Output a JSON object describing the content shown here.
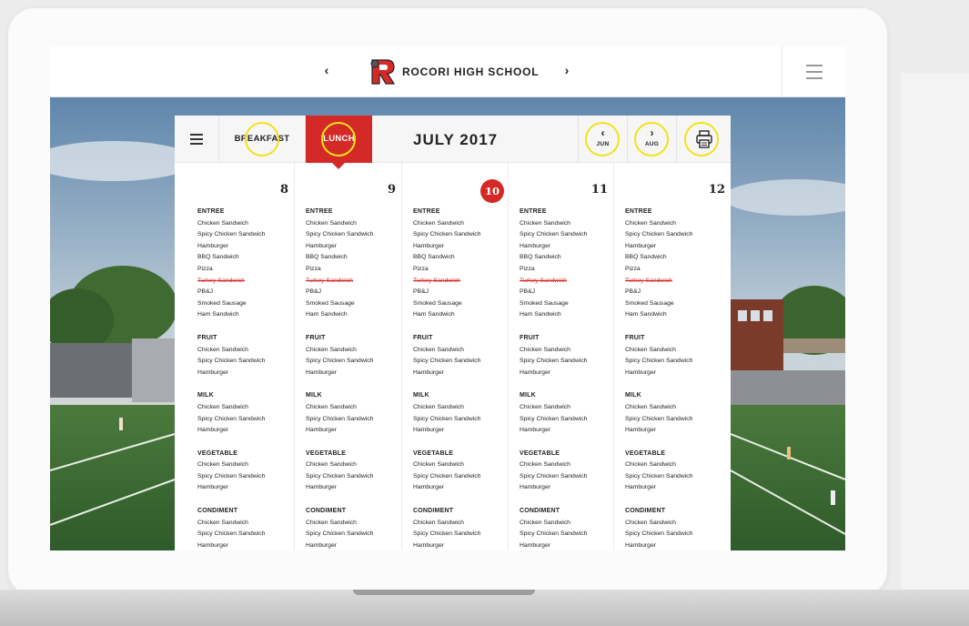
{
  "header": {
    "prev_arrow": "‹",
    "next_arrow": "›",
    "school_name": "ROCORI HIGH SCHOOL"
  },
  "tabs": {
    "breakfast": "BREAKFAST",
    "lunch": "LUNCH",
    "active": "LUNCH"
  },
  "calendar": {
    "month_title": "JULY 2017",
    "prev_arrow": "‹",
    "prev_label": "JUN",
    "next_arrow": "›",
    "next_label": "AUG"
  },
  "icons": {
    "logo": "school-mascot-logo",
    "menu": "menu-icon",
    "print": "printer-icon",
    "hamburger": "hamburger-icon"
  },
  "colors": {
    "accent": "#d42a27",
    "highlight_ring": "#f2e21b"
  },
  "days": [
    {
      "date": "8",
      "today": false,
      "sections": [
        {
          "title": "ENTREE",
          "items": [
            {
              "text": "Chicken Sandwich"
            },
            {
              "text": "Spicy Chicken Sandwich"
            },
            {
              "text": "Hamburger"
            },
            {
              "text": "BBQ Sandwich"
            },
            {
              "text": "Pizza"
            },
            {
              "text": "Turkey Sandwich",
              "struck": true
            },
            {
              "text": "PB&J"
            },
            {
              "text": "Smoked Sausage"
            },
            {
              "text": "Ham Sandwich"
            }
          ]
        },
        {
          "title": "FRUIT",
          "items": [
            {
              "text": "Chicken Sandwich"
            },
            {
              "text": "Spicy Chicken Sandwich"
            },
            {
              "text": "Hamburger"
            }
          ]
        },
        {
          "title": "MILK",
          "items": [
            {
              "text": "Chicken Sandwich"
            },
            {
              "text": "Spicy Chicken Sandwich"
            },
            {
              "text": "Hamburger"
            }
          ]
        },
        {
          "title": "VEGETABLE",
          "items": [
            {
              "text": "Chicken Sandwich"
            },
            {
              "text": "Spicy Chicken Sandwich"
            },
            {
              "text": "Hamburger"
            }
          ]
        },
        {
          "title": "CONDIMENT",
          "items": [
            {
              "text": "Chicken Sandwich"
            },
            {
              "text": "Spicy Chicken Sandwich"
            },
            {
              "text": "Hamburger"
            }
          ]
        }
      ]
    },
    {
      "date": "9",
      "today": false,
      "sections": [
        {
          "title": "ENTREE",
          "items": [
            {
              "text": "Chicken Sandwich"
            },
            {
              "text": "Spicy Chicken Sandwich"
            },
            {
              "text": "Hamburger"
            },
            {
              "text": "BBQ Sandwich"
            },
            {
              "text": "Pizza"
            },
            {
              "text": "Turkey Sandwich",
              "struck": true
            },
            {
              "text": "PB&J"
            },
            {
              "text": "Smoked Sausage"
            },
            {
              "text": "Ham Sandwich"
            }
          ]
        },
        {
          "title": "FRUIT",
          "items": [
            {
              "text": "Chicken Sandwich"
            },
            {
              "text": "Spicy Chicken Sandwich"
            },
            {
              "text": "Hamburger"
            }
          ]
        },
        {
          "title": "MILK",
          "items": [
            {
              "text": "Chicken Sandwich"
            },
            {
              "text": "Spicy Chicken Sandwich"
            },
            {
              "text": "Hamburger"
            }
          ]
        },
        {
          "title": "VEGETABLE",
          "items": [
            {
              "text": "Chicken Sandwich"
            },
            {
              "text": "Spicy Chicken Sandwich"
            },
            {
              "text": "Hamburger"
            }
          ]
        },
        {
          "title": "CONDIMENT",
          "items": [
            {
              "text": "Chicken Sandwich"
            },
            {
              "text": "Spicy Chicken Sandwich"
            },
            {
              "text": "Hamburger"
            }
          ]
        }
      ]
    },
    {
      "date": "10",
      "today": true,
      "sections": [
        {
          "title": "ENTREE",
          "items": [
            {
              "text": "Chicken Sandwich"
            },
            {
              "text": "Spicy Chicken Sandwich"
            },
            {
              "text": "Hamburger"
            },
            {
              "text": "BBQ Sandwich"
            },
            {
              "text": "Pizza"
            },
            {
              "text": "Turkey Sandwich",
              "struck": true
            },
            {
              "text": "PB&J"
            },
            {
              "text": "Smoked Sausage"
            },
            {
              "text": "Ham Sandwich"
            }
          ]
        },
        {
          "title": "FRUIT",
          "items": [
            {
              "text": "Chicken Sandwich"
            },
            {
              "text": "Spicy Chicken Sandwich"
            },
            {
              "text": "Hamburger"
            }
          ]
        },
        {
          "title": "MILK",
          "items": [
            {
              "text": "Chicken Sandwich"
            },
            {
              "text": "Spicy Chicken Sandwich"
            },
            {
              "text": "Hamburger"
            }
          ]
        },
        {
          "title": "VEGETABLE",
          "items": [
            {
              "text": "Chicken Sandwich"
            },
            {
              "text": "Spicy Chicken Sandwich"
            },
            {
              "text": "Hamburger"
            }
          ]
        },
        {
          "title": "CONDIMENT",
          "items": [
            {
              "text": "Chicken Sandwich"
            },
            {
              "text": "Spicy Chicken Sandwich"
            },
            {
              "text": "Hamburger"
            }
          ]
        }
      ]
    },
    {
      "date": "11",
      "today": false,
      "sections": [
        {
          "title": "ENTREE",
          "items": [
            {
              "text": "Chicken Sandwich"
            },
            {
              "text": "Spicy Chicken Sandwich"
            },
            {
              "text": "Hamburger"
            },
            {
              "text": "BBQ Sandwich"
            },
            {
              "text": "Pizza"
            },
            {
              "text": "Turkey Sandwich",
              "struck": true
            },
            {
              "text": "PB&J"
            },
            {
              "text": "Smoked Sausage"
            },
            {
              "text": "Ham Sandwich"
            }
          ]
        },
        {
          "title": "FRUIT",
          "items": [
            {
              "text": "Chicken Sandwich"
            },
            {
              "text": "Spicy Chicken Sandwich"
            },
            {
              "text": "Hamburger"
            }
          ]
        },
        {
          "title": "MILK",
          "items": [
            {
              "text": "Chicken Sandwich"
            },
            {
              "text": "Spicy Chicken Sandwich"
            },
            {
              "text": "Hamburger"
            }
          ]
        },
        {
          "title": "VEGETABLE",
          "items": [
            {
              "text": "Chicken Sandwich"
            },
            {
              "text": "Spicy Chicken Sandwich"
            },
            {
              "text": "Hamburger"
            }
          ]
        },
        {
          "title": "CONDIMENT",
          "items": [
            {
              "text": "Chicken Sandwich"
            },
            {
              "text": "Spicy Chicken Sandwich"
            },
            {
              "text": "Hamburger"
            }
          ]
        }
      ]
    },
    {
      "date": "12",
      "today": false,
      "sections": [
        {
          "title": "ENTREE",
          "items": [
            {
              "text": "Chicken Sandwich"
            },
            {
              "text": "Spicy Chicken Sandwich"
            },
            {
              "text": "Hamburger"
            },
            {
              "text": "BBQ Sandwich"
            },
            {
              "text": "Pizza"
            },
            {
              "text": "Turkey Sandwich",
              "struck": true
            },
            {
              "text": "PB&J"
            },
            {
              "text": "Smoked Sausage"
            },
            {
              "text": "Ham Sandwich"
            }
          ]
        },
        {
          "title": "FRUIT",
          "items": [
            {
              "text": "Chicken Sandwich"
            },
            {
              "text": "Spicy Chicken Sandwich"
            },
            {
              "text": "Hamburger"
            }
          ]
        },
        {
          "title": "MILK",
          "items": [
            {
              "text": "Chicken Sandwich"
            },
            {
              "text": "Spicy Chicken Sandwich"
            },
            {
              "text": "Hamburger"
            }
          ]
        },
        {
          "title": "VEGETABLE",
          "items": [
            {
              "text": "Chicken Sandwich"
            },
            {
              "text": "Spicy Chicken Sandwich"
            },
            {
              "text": "Hamburger"
            }
          ]
        },
        {
          "title": "CONDIMENT",
          "items": [
            {
              "text": "Chicken Sandwich"
            },
            {
              "text": "Spicy Chicken Sandwich"
            },
            {
              "text": "Hamburger"
            }
          ]
        }
      ]
    }
  ]
}
